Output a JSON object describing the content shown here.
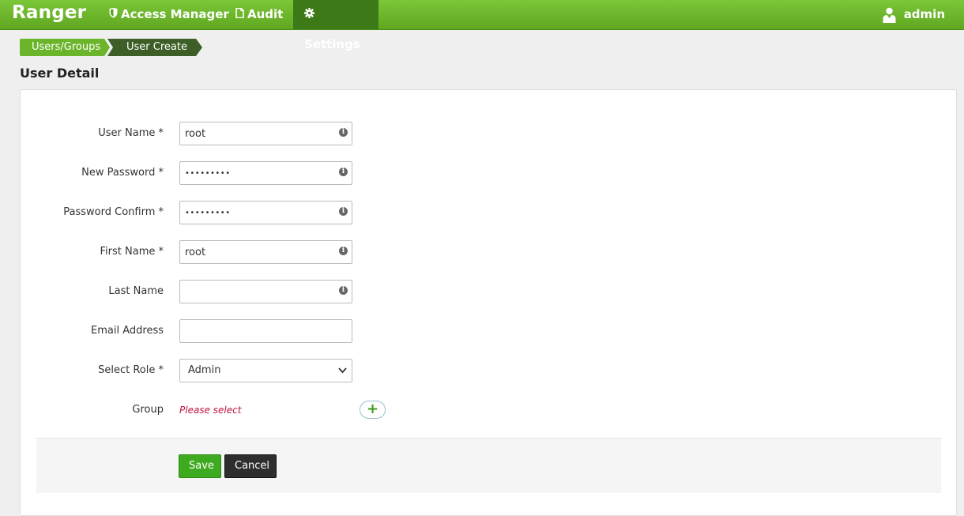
{
  "nav": {
    "brand": "Ranger",
    "items": [
      {
        "label": "Access Manager",
        "icon": "shield-icon"
      },
      {
        "label": "Audit",
        "icon": "file-icon"
      },
      {
        "label": "Settings",
        "icon": "gear-icon"
      }
    ],
    "user": "admin",
    "colors": {
      "bar": "#6bb52b",
      "active": "#3d7a17"
    }
  },
  "breadcrumb": [
    {
      "label": "Users/Groups"
    },
    {
      "label": "User Create"
    }
  ],
  "page_title": "User Detail",
  "form": {
    "user_name": {
      "label": "User Name *",
      "value": "root"
    },
    "new_password": {
      "label": "New Password *",
      "value": "•••••••••"
    },
    "password_confirm": {
      "label": "Password Confirm *",
      "value": "•••••••••"
    },
    "first_name": {
      "label": "First Name *",
      "value": "root"
    },
    "last_name": {
      "label": "Last Name",
      "value": ""
    },
    "email": {
      "label": "Email Address",
      "value": ""
    },
    "role": {
      "label": "Select Role *",
      "selected": "Admin"
    },
    "group": {
      "label": "Group",
      "placeholder": "Please select",
      "add_symbol": "+"
    }
  },
  "buttons": {
    "save": "Save",
    "cancel": "Cancel"
  }
}
